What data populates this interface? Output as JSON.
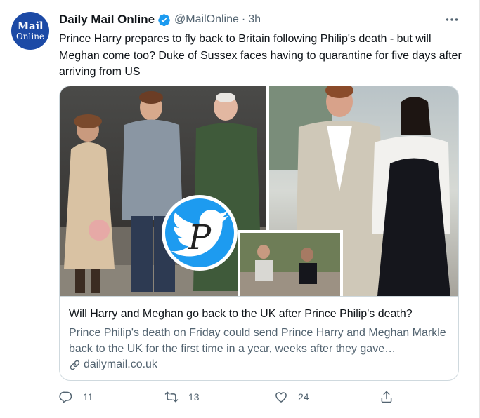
{
  "account": {
    "name": "Daily Mail Online",
    "handle": "@MailOnline",
    "separator": "·",
    "time": "3h",
    "avatar_line1": "Mail",
    "avatar_line2": "Online"
  },
  "tweet_text": "Prince Harry prepares to fly back to Britain following Philip's death - but will Meghan come too? Duke of Sussex faces having to quarantine for five days after arriving from US",
  "card": {
    "title": "Will Harry and Meghan go back to the UK after Prince Philip's death?",
    "description": "Prince Philip's death on Friday could send Prince Harry and Meghan Markle back to the UK for the first time in a year, weeks after they gave…",
    "domain": "dailymail.co.uk",
    "watermark_letter": "P"
  },
  "actions": {
    "reply_count": "11",
    "retweet_count": "13",
    "like_count": "24"
  },
  "colors": {
    "avatar_bg": "#1c4aa6",
    "twitter_blue": "#1d9bf0",
    "secondary_text": "#536471"
  }
}
